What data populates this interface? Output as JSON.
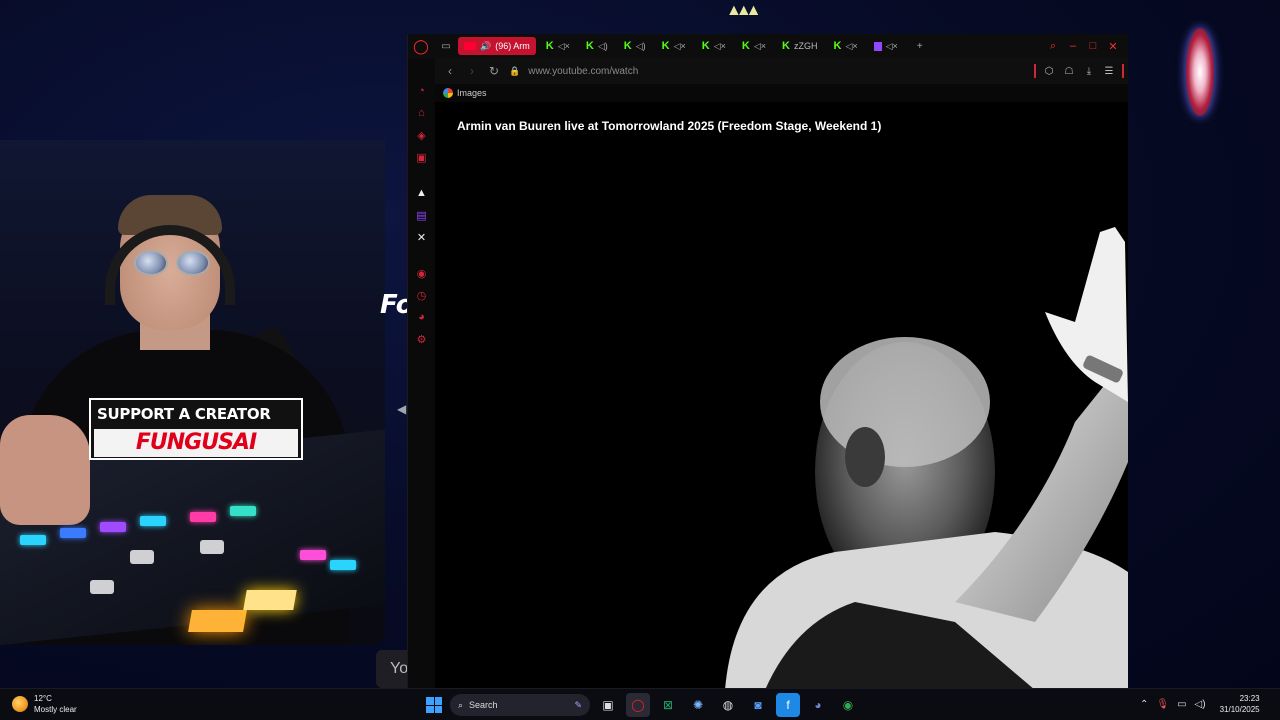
{
  "overlay": {
    "support_label": "SUPPORT A CREATOR",
    "creator_code": "FUNGUSAI",
    "partial_text": "Fo",
    "card_text": "Yo"
  },
  "browser": {
    "tabs": [
      {
        "label": "(96) Arm",
        "favicon": "youtube-icon",
        "sound": "speaker-icon",
        "active": true
      },
      {
        "label": "",
        "favicon": "kick-icon",
        "sound": "muted-speaker-icon",
        "active": false
      },
      {
        "label": "",
        "favicon": "kick-icon",
        "sound": "speaker-icon",
        "active": false
      },
      {
        "label": "",
        "favicon": "kick-icon",
        "sound": "speaker-icon",
        "active": false
      },
      {
        "label": "",
        "favicon": "kick-icon",
        "sound": "muted-speaker-icon",
        "active": false
      },
      {
        "label": "",
        "favicon": "kick-icon",
        "sound": "muted-speaker-icon",
        "active": false
      },
      {
        "label": "",
        "favicon": "kick-icon",
        "sound": "muted-speaker-icon",
        "active": false
      },
      {
        "label": "zZGH",
        "favicon": "kick-icon",
        "sound": "",
        "active": false
      },
      {
        "label": "",
        "favicon": "kick-icon",
        "sound": "muted-speaker-icon",
        "active": false
      },
      {
        "label": "",
        "favicon": "twitch-icon",
        "sound": "muted-speaker-icon",
        "active": false
      }
    ],
    "url": "www.youtube.com/watch",
    "bookmark_label": "Images",
    "video_title": "Armin van Buuren live at Tomorrowland 2025 (Freedom Stage, Weekend 1)",
    "accent_color": "#d2253a"
  },
  "taskbar": {
    "temperature": "12°C",
    "weather_desc": "Mostly clear",
    "search_placeholder": "Search",
    "time": "23:23",
    "date": "31/10/2025"
  }
}
